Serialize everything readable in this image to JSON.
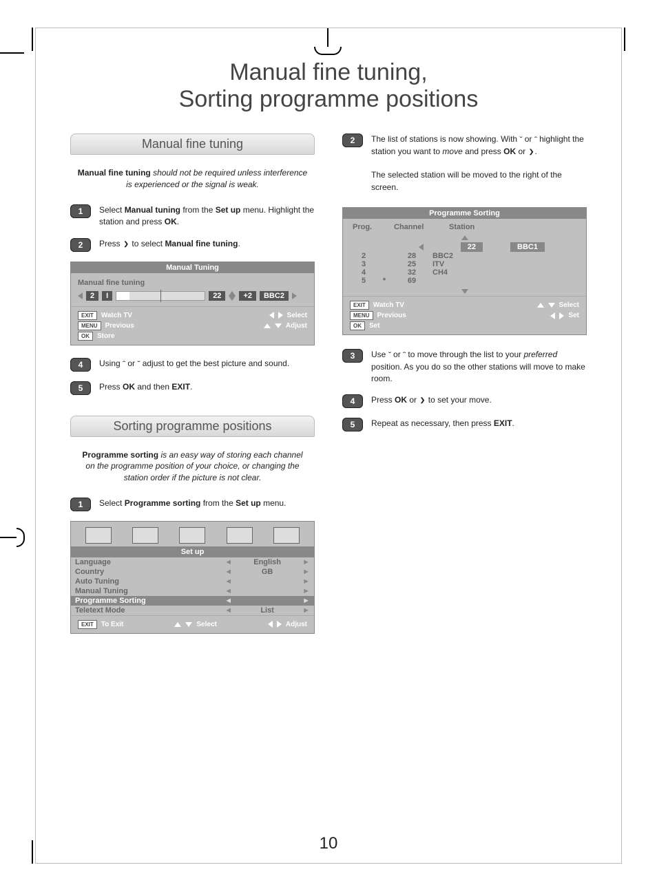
{
  "title_line1": "Manual fine tuning,",
  "title_line2": "Sorting programme positions",
  "page_number": "10",
  "left": {
    "sect1_head": "Manual fine tuning",
    "intro_bold": "Manual fine tuning",
    "intro_ital": " should not be required unless interference is experienced or the signal is weak.",
    "s1": "Select ",
    "s1b": "Manual tuning",
    "s1c": " from the ",
    "s1d": "Set up",
    "s1e": " menu. Highlight the station and press ",
    "s1f": "OK",
    "s1g": ".",
    "s2a": "Press ",
    "s2b": " to select ",
    "s2c": "Manual fine tuning",
    "s2d": ".",
    "osd1_title": "Manual Tuning",
    "osd1_sub": "Manual fine tuning",
    "osd1_prog": "2",
    "osd1_sys": "I",
    "osd1_ch": "22",
    "osd1_off": "+2",
    "osd1_name": "BBC2",
    "foot_exit_k": "EXIT",
    "foot_exit": "Watch TV",
    "foot_menu_k": "MENU",
    "foot_prev": "Previous",
    "foot_ok_k": "OK",
    "foot_store": "Store",
    "foot_select": "Select",
    "foot_adjust": "Adjust",
    "s4a": "Using ",
    "s4b": " or ",
    "s4c": " adjust to get the best picture and sound.",
    "s5a": "Press ",
    "s5b": "OK",
    "s5c": " and then ",
    "s5d": "EXIT",
    "s5e": ".",
    "sect2_head": "Sorting programme positions",
    "intro2_bold": "Programme sorting",
    "intro2_ital": " is an easy way of storing each channel on the programme position of your choice, or changing the station order if the picture is not clear.",
    "s21a": "Select ",
    "s21b": "Programme sorting",
    "s21c": " from the ",
    "s21d": "Set up",
    "s21e": " menu.",
    "setup_title": "Set up",
    "setup_rows": [
      {
        "label": "Language",
        "val": "English"
      },
      {
        "label": "Country",
        "val": "GB"
      },
      {
        "label": "Auto Tuning",
        "val": ""
      },
      {
        "label": "Manual Tuning",
        "val": ""
      },
      {
        "label": "Programme Sorting",
        "val": "",
        "hl": true
      },
      {
        "label": "Teletext Mode",
        "val": "List"
      }
    ],
    "setup_foot_exit": "To Exit",
    "setup_foot_sel": "Select",
    "setup_foot_adj": "Adjust"
  },
  "right": {
    "s2a": "The list of stations is now showing. With ",
    "s2b": " or ",
    "s2c": " highlight the station you want to ",
    "s2d": "move",
    "s2e": " and press ",
    "s2f": "OK",
    "s2g": " or ",
    "s2h": ".",
    "s2i": "The selected station will be moved to the right of the screen.",
    "sort_title": "Programme Sorting",
    "col_prog": "Prog.",
    "col_ch": "Channel",
    "col_st": "Station",
    "hl_ch": "22",
    "hl_name": "BBC1",
    "rows": [
      {
        "p": "2",
        "m": "",
        "c": "28",
        "s": "BBC2"
      },
      {
        "p": "3",
        "m": "",
        "c": "25",
        "s": "ITV"
      },
      {
        "p": "4",
        "m": "",
        "c": "32",
        "s": "CH4"
      },
      {
        "p": "5",
        "m": "*",
        "c": "69",
        "s": ""
      }
    ],
    "foot_set": "Set",
    "s3a": "Use ",
    "s3b": " or ",
    "s3c": " to move through the list to your ",
    "s3d": "preferred",
    "s3e": " position. As you do so the other stations will move to make room.",
    "s4a": "Press ",
    "s4b": "OK",
    "s4c": " or ",
    "s4d": " to set your move.",
    "s5a": "Repeat as necessary, then press ",
    "s5b": "EXIT",
    "s5c": "."
  }
}
